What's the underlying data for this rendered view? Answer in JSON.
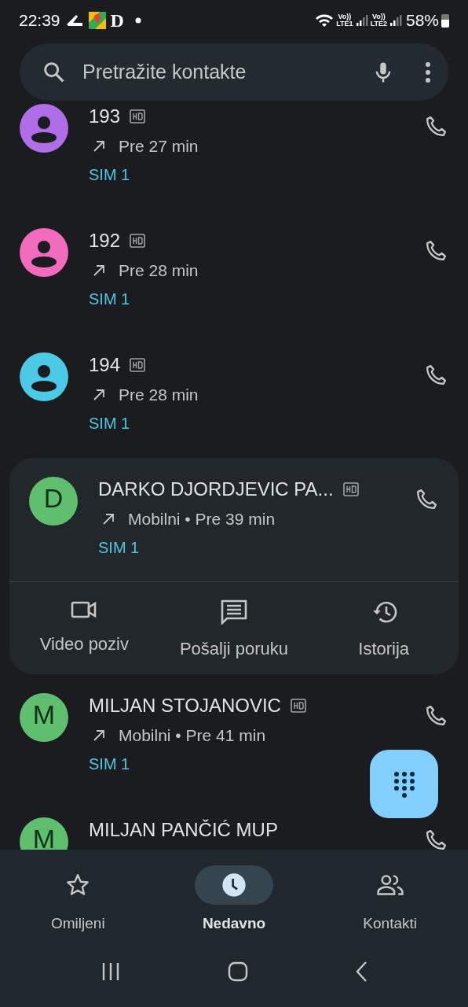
{
  "status_bar": {
    "time": "22:39",
    "notifications": [
      {
        "kind": "shoe"
      },
      {
        "kind": "map"
      },
      {
        "kind": "letter",
        "text": "D"
      },
      {
        "kind": "dot"
      }
    ],
    "sim_indicators": [
      {
        "top": "Vo))",
        "bottom": "LTE1"
      },
      {
        "top": "Vo))",
        "bottom": "LTE2"
      }
    ],
    "battery": "58%"
  },
  "search": {
    "placeholder": "Pretražite kontakte"
  },
  "calls": [
    {
      "name": "193",
      "hd": true,
      "avatar": {
        "kind": "person",
        "color": "#b06de8"
      },
      "kind": "outgoing",
      "detail": "Pre 27 min",
      "sim": "SIM 1",
      "expanded": false
    },
    {
      "name": "192",
      "hd": true,
      "avatar": {
        "kind": "person",
        "color": "#f26bbd"
      },
      "kind": "outgoing",
      "detail": "Pre 28 min",
      "sim": "SIM 1",
      "expanded": false
    },
    {
      "name": "194",
      "hd": true,
      "avatar": {
        "kind": "person",
        "color": "#4cc9e4"
      },
      "kind": "outgoing",
      "detail": "Pre 28 min",
      "sim": "SIM 1",
      "expanded": false
    },
    {
      "name": "DARKO DJORDJEVIC PA...",
      "hd": true,
      "avatar": {
        "kind": "letter",
        "letter": "D",
        "color": "#5fbf6e"
      },
      "kind": "outgoing",
      "detail": "Mobilni • Pre 39 min",
      "sim": "SIM 1",
      "expanded": true,
      "actions": [
        {
          "kind": "video",
          "label": "Video poziv"
        },
        {
          "kind": "message",
          "label": "Pošalji poruku"
        },
        {
          "kind": "history",
          "label": "Istorija"
        }
      ]
    },
    {
      "name": "MILJAN STOJANOVIC",
      "hd": true,
      "avatar": {
        "kind": "letter",
        "letter": "M",
        "color": "#5fbf6e"
      },
      "kind": "outgoing",
      "detail": "Mobilni • Pre 41 min",
      "sim": "SIM 1",
      "expanded": false
    },
    {
      "name": "MILJAN PANČIĆ MUP",
      "hd": false,
      "avatar": {
        "kind": "letter",
        "letter": "M",
        "color": "#5fbf6e"
      },
      "expanded": false
    }
  ],
  "bottom_nav": [
    {
      "kind": "star",
      "label": "Omiljeni",
      "selected": false
    },
    {
      "kind": "clock",
      "label": "Nedavno",
      "selected": true
    },
    {
      "kind": "people",
      "label": "Kontakti",
      "selected": false
    }
  ]
}
